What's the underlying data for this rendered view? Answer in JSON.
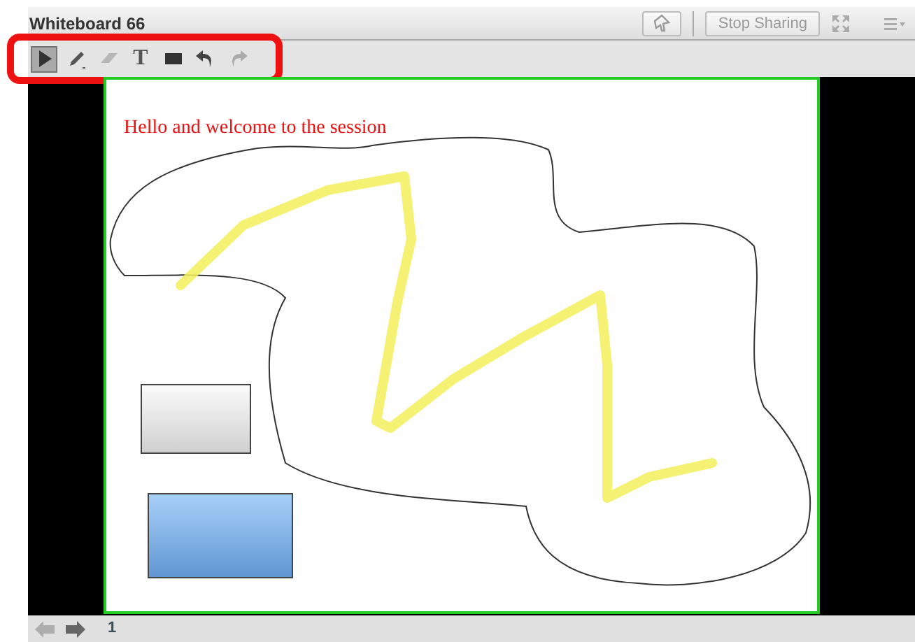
{
  "window": {
    "title": "Whiteboard 66"
  },
  "header_buttons": {
    "stop_sharing": "Stop Sharing"
  },
  "tools": [
    {
      "kind": "select",
      "selected": true,
      "disabled": false
    },
    {
      "kind": "pen",
      "selected": false,
      "disabled": false
    },
    {
      "kind": "eraser",
      "selected": false,
      "disabled": true
    },
    {
      "kind": "text",
      "glyph": "T",
      "selected": false,
      "disabled": false
    },
    {
      "kind": "shape",
      "selected": false,
      "disabled": false
    },
    {
      "kind": "undo",
      "selected": false,
      "disabled": false
    },
    {
      "kind": "redo",
      "selected": false,
      "disabled": true
    }
  ],
  "board": {
    "text": "Hello and welcome to the session"
  },
  "pager": {
    "prev_disabled": true,
    "next_disabled": false,
    "page": "1"
  }
}
